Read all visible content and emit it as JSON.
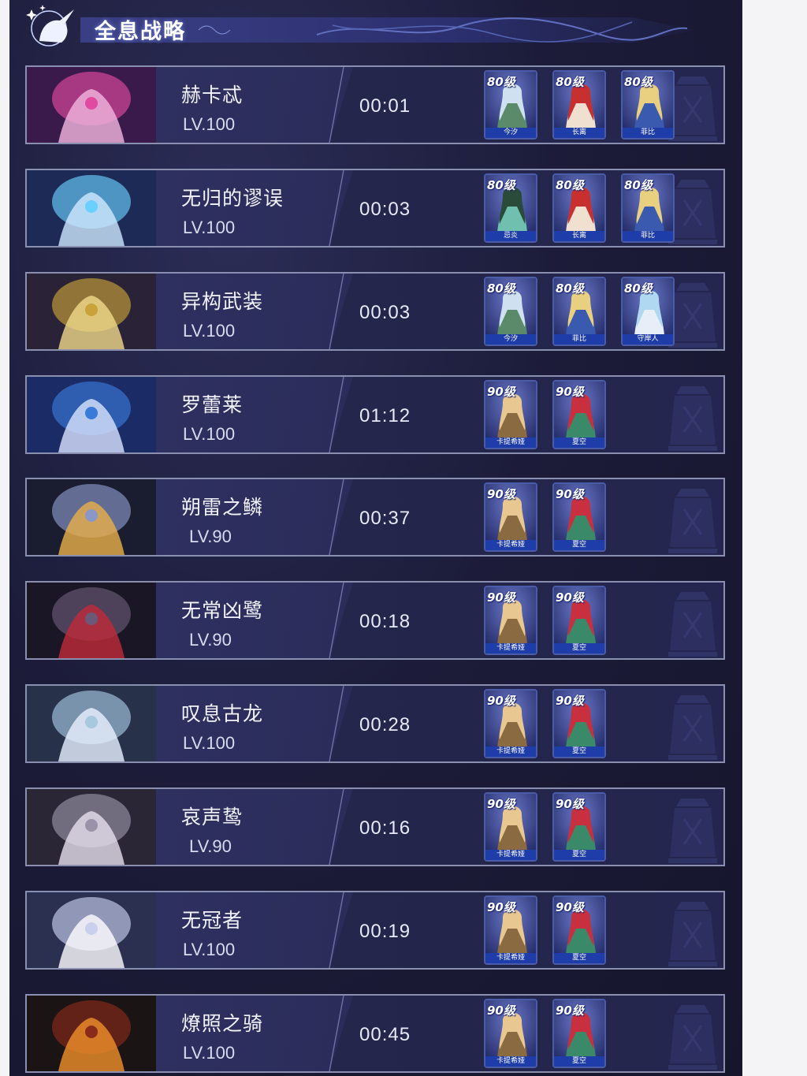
{
  "header": {
    "title": "全息战略",
    "icon": "unicorn-icon"
  },
  "colors": {
    "background": "#1c1c3a",
    "row_border": "#8a8fb0",
    "card_border": "#4a5ba8",
    "card_name_bar": "#1f3da8"
  },
  "bosses": [
    {
      "name": "赫卡忒",
      "level": "LV.100",
      "time": "00:01",
      "team": [
        {
          "level": "80级",
          "name": "今汐"
        },
        {
          "level": "80级",
          "name": "长离"
        },
        {
          "level": "80级",
          "name": "菲比"
        }
      ]
    },
    {
      "name": "无归的谬误",
      "level": "LV.100",
      "time": "00:03",
      "team": [
        {
          "level": "80级",
          "name": "忌炎"
        },
        {
          "level": "80级",
          "name": "长离"
        },
        {
          "level": "80级",
          "name": "菲比"
        }
      ]
    },
    {
      "name": "异构武装",
      "level": "LV.100",
      "time": "00:03",
      "team": [
        {
          "level": "80级",
          "name": "今汐"
        },
        {
          "level": "80级",
          "name": "菲比"
        },
        {
          "level": "80级",
          "name": "守岸人"
        }
      ]
    },
    {
      "name": "罗蕾莱",
      "level": "LV.100",
      "time": "01:12",
      "team": [
        {
          "level": "90级",
          "name": "卡提希娅"
        },
        {
          "level": "90级",
          "name": "夏空"
        }
      ]
    },
    {
      "name": "朔雷之鳞",
      "level": "LV.90",
      "time": "00:37",
      "team": [
        {
          "level": "90级",
          "name": "卡提希娅"
        },
        {
          "level": "90级",
          "name": "夏空"
        }
      ]
    },
    {
      "name": "无常凶鹭",
      "level": "LV.90",
      "time": "00:18",
      "team": [
        {
          "level": "90级",
          "name": "卡提希娅"
        },
        {
          "level": "90级",
          "name": "夏空"
        }
      ]
    },
    {
      "name": "叹息古龙",
      "level": "LV.100",
      "time": "00:28",
      "team": [
        {
          "level": "90级",
          "name": "卡提希娅"
        },
        {
          "level": "90级",
          "name": "夏空"
        }
      ]
    },
    {
      "name": "哀声鸷",
      "level": "LV.90",
      "time": "00:16",
      "team": [
        {
          "level": "90级",
          "name": "卡提希娅"
        },
        {
          "level": "90级",
          "name": "夏空"
        }
      ]
    },
    {
      "name": "无冠者",
      "level": "LV.100",
      "time": "00:19",
      "team": [
        {
          "level": "90级",
          "name": "卡提希娅"
        },
        {
          "level": "90级",
          "name": "夏空"
        }
      ]
    },
    {
      "name": "燎照之骑",
      "level": "LV.100",
      "time": "00:45",
      "team": [
        {
          "level": "90级",
          "name": "卡提希娅"
        },
        {
          "level": "90级",
          "name": "夏空"
        }
      ]
    }
  ]
}
